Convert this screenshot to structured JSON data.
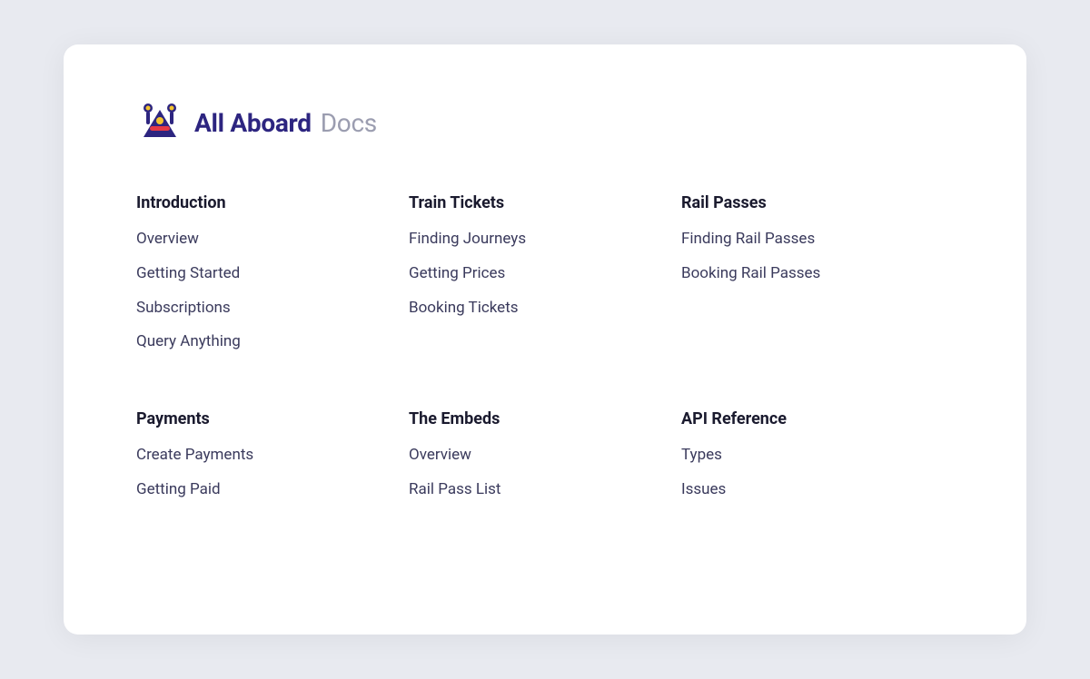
{
  "logo": {
    "brand": "All Aboard",
    "docs": "Docs"
  },
  "sections": [
    {
      "id": "introduction",
      "title": "Introduction",
      "items": [
        "Overview",
        "Getting Started",
        "Subscriptions",
        "Query Anything"
      ]
    },
    {
      "id": "train-tickets",
      "title": "Train Tickets",
      "items": [
        "Finding Journeys",
        "Getting Prices",
        "Booking Tickets"
      ]
    },
    {
      "id": "rail-passes",
      "title": "Rail Passes",
      "items": [
        "Finding Rail Passes",
        "Booking Rail Passes"
      ]
    },
    {
      "id": "payments",
      "title": "Payments",
      "items": [
        "Create Payments",
        "Getting Paid"
      ]
    },
    {
      "id": "the-embeds",
      "title": "The Embeds",
      "items": [
        "Overview",
        "Rail Pass List"
      ]
    },
    {
      "id": "api-reference",
      "title": "API Reference",
      "items": [
        "Types",
        "Issues"
      ]
    }
  ]
}
